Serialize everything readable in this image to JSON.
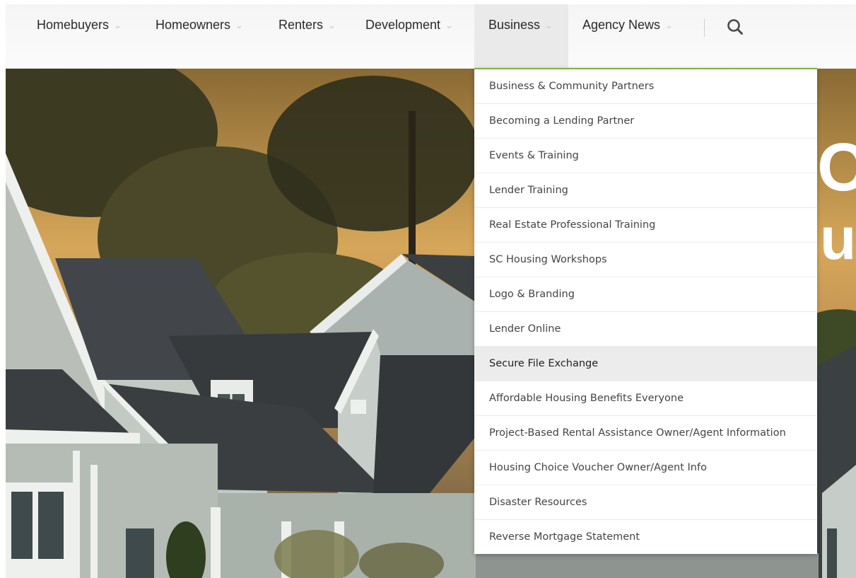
{
  "nav": {
    "items": [
      {
        "label": "Homebuyers",
        "chevron": "⌄"
      },
      {
        "label": "Homeowners",
        "chevron": "⌄"
      },
      {
        "label": "Renters",
        "chevron": "⌄"
      },
      {
        "label": "Development",
        "chevron": "⌄"
      },
      {
        "label": "Business",
        "chevron": "⌄"
      },
      {
        "label": "Agency News",
        "chevron": "⌄"
      }
    ],
    "search_icon": "search-icon"
  },
  "hero": {
    "partial_text_top": "O",
    "partial_text_bottom": "u"
  },
  "dropdown": {
    "items": [
      "Business & Community Partners",
      "Becoming a Lending Partner",
      "Events & Training",
      "Lender Training",
      "Real Estate Professional Training",
      "SC Housing Workshops",
      "Logo & Branding",
      "Lender Online",
      "Secure File Exchange",
      "Affordable Housing Benefits Everyone",
      "Project-Based Rental Assistance Owner/Agent Information",
      "Housing Choice Voucher Owner/Agent Info",
      "Disaster Resources",
      "Reverse Mortgage Statement"
    ]
  },
  "colors": {
    "accent": "#7cb342",
    "nav_text": "#2a2a2a",
    "menu_text": "#444444",
    "hover_bg": "#ececec"
  }
}
